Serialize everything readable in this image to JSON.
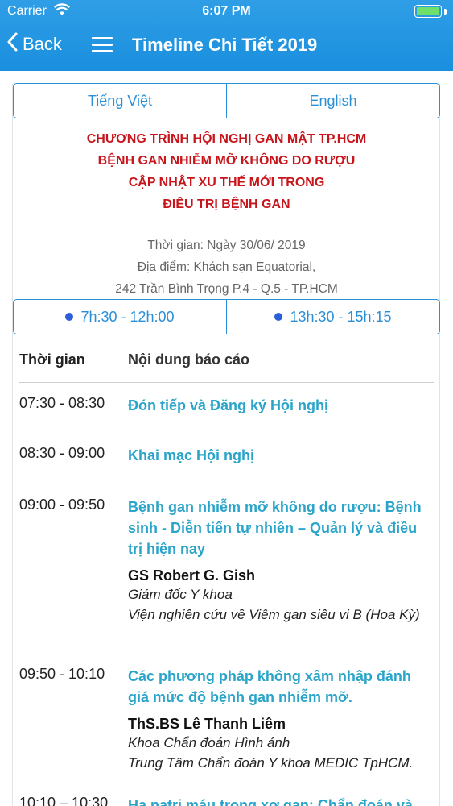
{
  "status": {
    "carrier": "Carrier",
    "time": "6:07 PM"
  },
  "nav": {
    "back_label": "Back",
    "title": "Timeline Chi Tiết 2019"
  },
  "language": {
    "vi": "Tiếng Việt",
    "en": "English"
  },
  "conference_title": [
    "CHƯƠNG TRÌNH HỘI NGHỊ GAN MẬT TP.HCM",
    "BỆNH GAN NHIỄM MỠ KHÔNG DO RƯỢU",
    "CẬP NHẬT XU THẾ MỚI TRONG",
    "ĐIỀU TRỊ BỆNH GAN"
  ],
  "info": [
    "Thời gian: Ngày 30/06/ 2019",
    "Địa điểm: Khách sạn Equatorial,",
    "242 Trần Bình Trọng P.4 - Q.5 - TP.HCM"
  ],
  "sessions": {
    "morning": "7h:30 - 12h:00",
    "afternoon": "13h:30 - 15h:15"
  },
  "table": {
    "header_time": "Thời gian",
    "header_content": "Nội dung báo cáo",
    "rows": [
      {
        "time": "07:30 - 08:30",
        "topic": "Đón tiếp và Đăng ký Hội nghị"
      },
      {
        "time": "08:30 - 09:00",
        "topic": "Khai mạc Hội nghị"
      },
      {
        "time": "09:00 - 09:50",
        "topic": "Bệnh gan nhiễm mỡ không do rượu: Bệnh sinh - Diễn tiến tự nhiên – Quản lý và điều trị hiện nay",
        "speaker": "GS Robert G. Gish",
        "affil1": "Giám đốc Y khoa",
        "affil2": "Viện nghiên cứu về Viêm gan siêu vi B (Hoa Kỳ)"
      },
      {
        "time": "09:50 - 10:10",
        "topic": "Các phương pháp không xâm nhập đánh giá mức độ bệnh gan nhiễm mỡ.",
        "speaker": "ThS.BS Lê Thanh Liêm",
        "affil1": "Khoa Chẩn đoán Hình ảnh",
        "affil2": "Trung Tâm Chẩn đoán Y khoa MEDIC TpHCM."
      },
      {
        "time": "10:10 – 10:30",
        "topic": "Hạ natri máu trong xơ gan: Chẩn đoán và"
      }
    ]
  },
  "colors": {
    "header_blue": "#1a8fde",
    "accent_blue": "#2b8fd8",
    "title_red": "#c8151b",
    "topic_teal": "#2ba4c9"
  }
}
